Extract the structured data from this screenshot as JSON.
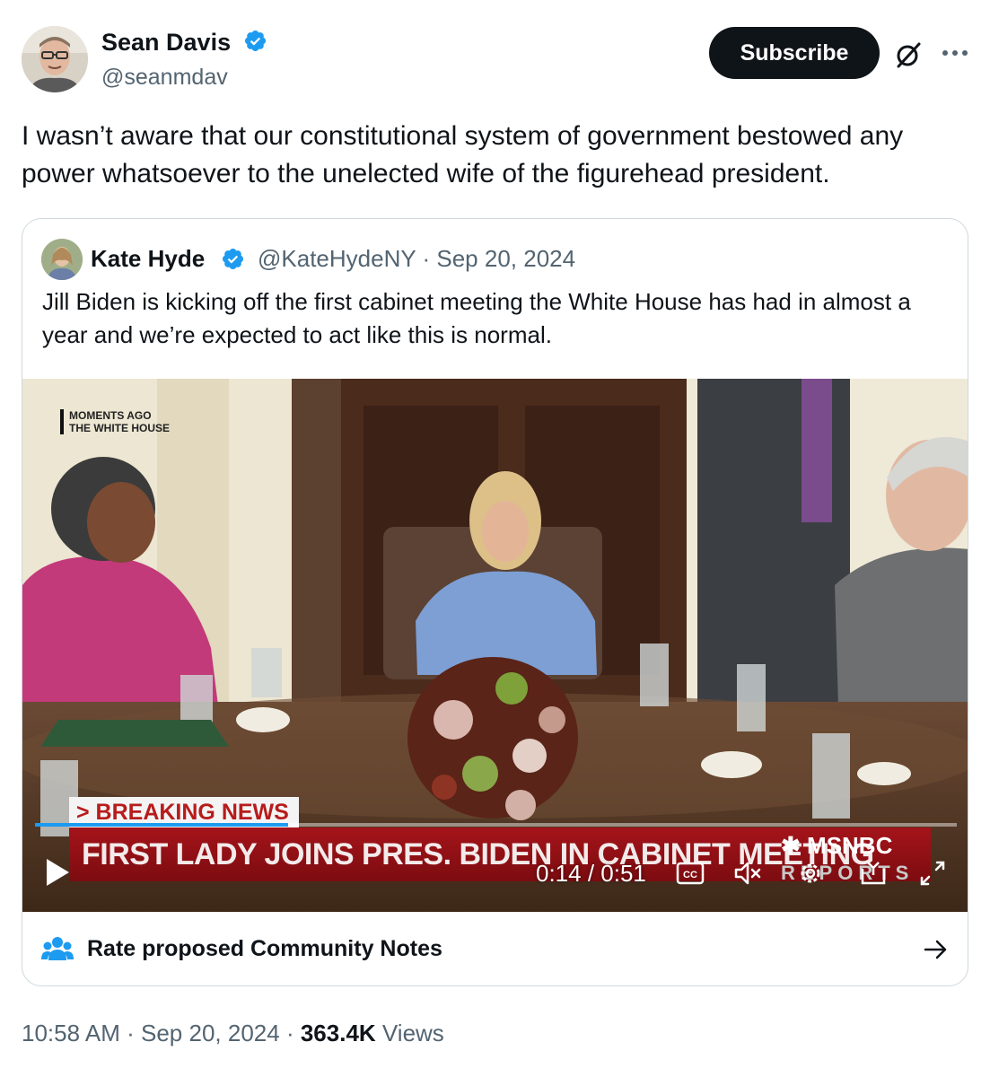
{
  "post": {
    "author_name": "Sean Davis",
    "author_handle": "@seanmdav",
    "subscribe_label": "Subscribe",
    "text": "I wasn’t aware that our constitutional system of government bestowed any power whatsoever to the unelected wife of the figurehead president.",
    "time": "10:58 AM",
    "date": "Sep 20, 2024",
    "views_count": "363.4K",
    "views_label": "Views",
    "separator": "·"
  },
  "quote": {
    "author_name": "Kate Hyde",
    "author_handle": "@KateHydeNY",
    "date": "Sep 20, 2024",
    "text": "Jill Biden is kicking off the first cabinet meeting the White House has had in almost a year and we’re expected to act like this is normal.",
    "video": {
      "bug_line1": "MOMENTS AGO",
      "bug_line2": "THE WHITE HOUSE",
      "breaking": "> BREAKING NEWS",
      "headline": "FIRST LADY JOINS PRES. BIDEN IN CABINET MEETING",
      "network": "MSNBC",
      "network_sub": "REPORTS",
      "time_display": "0:14 / 0:51",
      "progress": 0.275
    }
  },
  "community_notes": {
    "label": "Rate proposed Community Notes"
  },
  "icons": {
    "verified": "verified-badge-icon",
    "grok": "grok-icon",
    "more": "more-icon",
    "play": "play-icon",
    "captions": "captions-icon",
    "mute": "mute-icon",
    "settings": "settings-icon",
    "pip": "pip-icon",
    "fullscreen": "fullscreen-icon",
    "notes": "community-notes-icon",
    "arrow": "arrow-right-icon"
  },
  "colors": {
    "accent": "#1d9bf0",
    "text": "#0f1419",
    "muted": "#536471",
    "border": "#cfd9de",
    "news_red": "#a4141a"
  }
}
